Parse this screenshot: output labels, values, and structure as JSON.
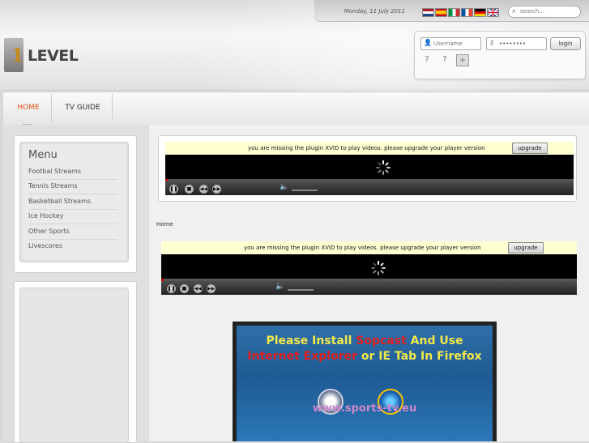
{
  "header": {
    "date": "Monday, 11 July 2011",
    "flags": [
      "nl",
      "es",
      "it",
      "fr",
      "de",
      "en"
    ],
    "search_placeholder": "search...",
    "logo_text": "LEVEL",
    "logo_digit": "1"
  },
  "login": {
    "username_placeholder": "Username",
    "password_value": "••••••••",
    "button_label": "login"
  },
  "nav": {
    "items": [
      {
        "label": "HOME",
        "active": true
      },
      {
        "label": "TV GUIDE",
        "active": false
      }
    ],
    "active_color": "#e8521e"
  },
  "menu": {
    "title": "Menu",
    "items": [
      "Footbal Streams",
      "Tennis Streams",
      "Basketball Streams",
      "Ice Hockey",
      "Other Sports",
      "Livescores"
    ]
  },
  "players": [
    {
      "plugin_message": "you are missing the plugin XVID to play videos. please upgrade your player version",
      "upgrade_label": "upgrade"
    },
    {
      "plugin_message": "you are missing the plugin XVID to play videos. please upgrade your player version",
      "upgrade_label": "upgrade"
    }
  ],
  "breadcrumb": "Home",
  "banner": {
    "line1_parts": [
      {
        "text": "Please Install ",
        "color": "#f2e84a"
      },
      {
        "text": "Sopcast",
        "color": "#e02020"
      },
      {
        "text": " And Use",
        "color": "#f2e84a"
      }
    ],
    "line2_parts": [
      {
        "text": "Internet Explorer",
        "color": "#e02020"
      },
      {
        "text": " or IE Tab In Firefox",
        "color": "#f2e84a"
      }
    ],
    "url": "www.sports-tv.eu"
  }
}
